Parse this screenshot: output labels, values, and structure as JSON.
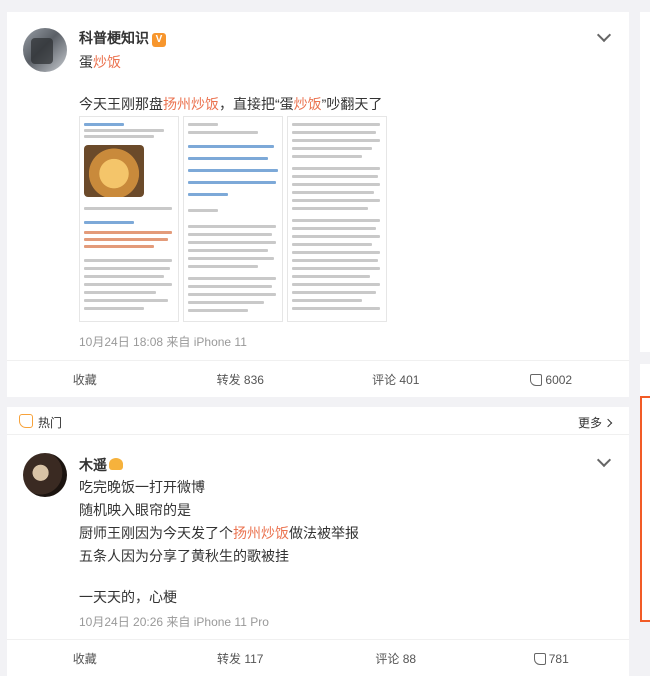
{
  "post1": {
    "username": "科普梗知识",
    "badge": "V",
    "topic_prefix": "蛋",
    "topic_highlight": "炒饭",
    "text_a": "今天王刚那盘",
    "text_hl1": "扬州炒饭",
    "text_b": "，直接把“蛋",
    "text_hl2": "炒饭",
    "text_c": "”吵翻天了",
    "meta": "10月24日 18:08  来自 iPhone 11",
    "actions": {
      "save": "收藏",
      "repost": "转发 836",
      "comment": "评论 401",
      "like": "6002"
    }
  },
  "post2": {
    "hot_label": "热门",
    "more_label": "更多",
    "username": "木遥",
    "line1": "吃完晚饭一打开微博",
    "line2": "随机映入眼帘的是",
    "line3_a": "厨师王刚因为今天发了个",
    "line3_hl": "扬州炒饭",
    "line3_b": "做法被举报",
    "line4": "五条人因为分享了黄秋生的歌被挂",
    "line5": "一天天的，心梗",
    "meta": "10月24日 20:26  来自 iPhone 11 Pro",
    "actions": {
      "save": "收藏",
      "repost": "转发 117",
      "comment": "评论 88",
      "like": "781"
    }
  },
  "colors": {
    "highlight": "#eb7350",
    "accent_border": "#f25b26",
    "badge": "#f7962d"
  }
}
